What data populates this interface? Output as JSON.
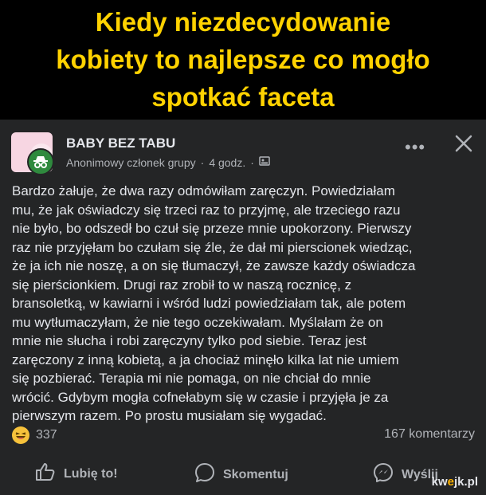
{
  "meme": {
    "title_lines": [
      "Kiedy niezdecydowanie",
      "kobiety to najlepsze co mogło",
      "spotkać faceta"
    ]
  },
  "post": {
    "group_name": "BABY BEZ TABU",
    "author": "Anonimowy członek grupy",
    "time": "4 godz.",
    "separator": "·",
    "more_label": "•••",
    "body_lines": [
      "Bardzo żałuje, że dwa razy odmówiłam zaręczyn. Powiedziałam",
      "mu, że jak oświadczy się trzeci raz to przyjmę, ale trzeciego razu",
      "nie było, bo odszedł bo czuł się przeze mnie upokorzony. Pierwszy",
      "raz nie przyjęłam bo czułam się źle, że dał mi pierscionek wiedząc,",
      "że ja ich nie noszę, a on się tłumaczył, że zawsze każdy oświadcza",
      "się pierścionkiem. Drugi raz zrobił to w naszą rocznicę, z",
      "bransoletką, w kawiarni i wśród ludzi powiedziałam tak, ale potem",
      "mu wytłumaczyłam, że nie tego oczekiwałam. Myślałam że on",
      "mnie nie słucha i robi zaręczyny tylko pod siebie. Teraz jest",
      "zaręczony z inną kobietą, a ja chociaż minęło kilka lat nie umiem",
      "się pozbierać. Terapia mi nie pomaga, on nie chciał do mnie",
      "wrócić. Gdybym mogła cofnełabym się w czasie i przyjęła je za",
      "pierwszym razem. Po prostu musiałam się wygadać."
    ],
    "reaction_count": "337",
    "comment_count": "167 komentarzy",
    "actions": {
      "like": "Lubię to!",
      "comment": "Skomentuj",
      "share": "Wyślij"
    }
  },
  "watermark": {
    "prefix": "kw",
    "mid": "e",
    "suffix": "jk.pl"
  },
  "colors": {
    "title": "#ffd200",
    "card_bg": "#242526",
    "text": "#e4e6eb",
    "muted": "#b0b3b8"
  }
}
